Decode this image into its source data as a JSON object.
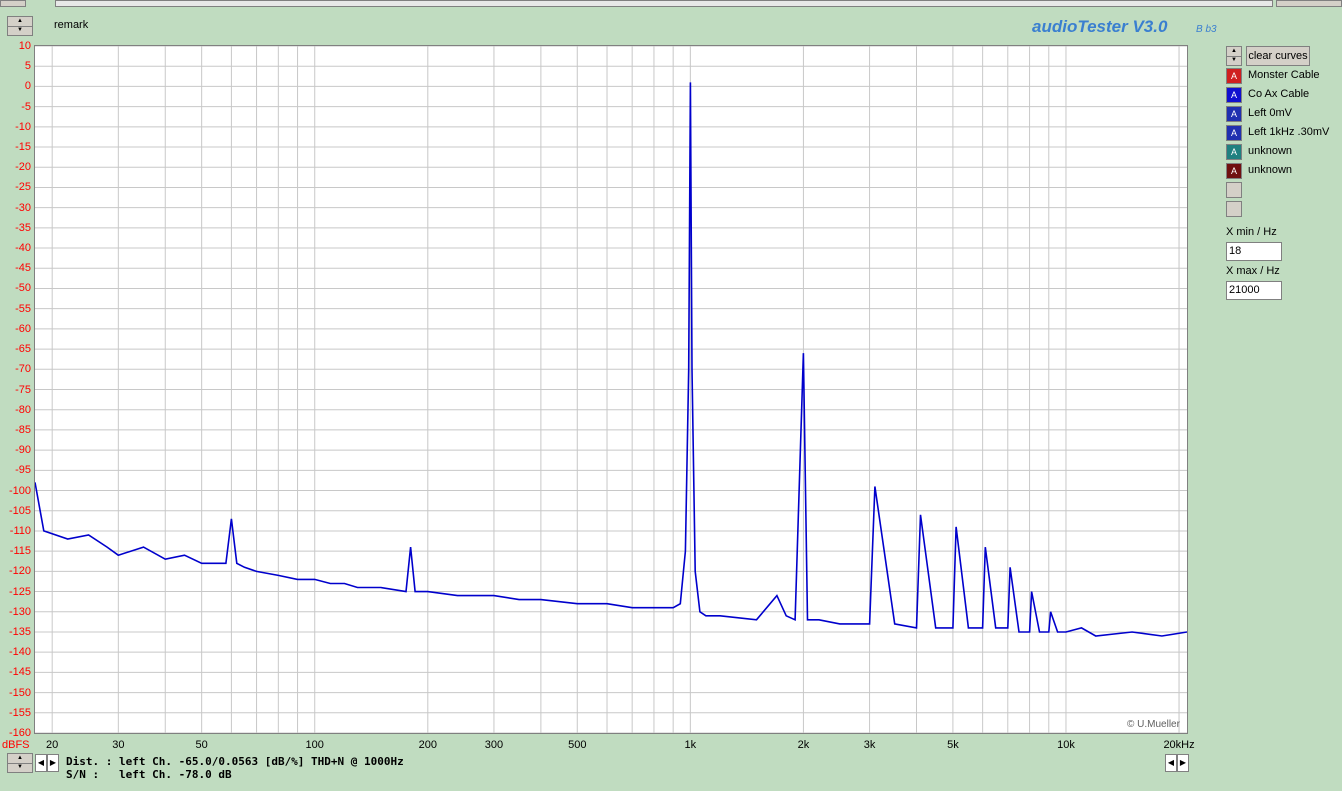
{
  "window": {
    "remark_label": "remark",
    "title": "audioTester V3.0",
    "build": "B b3",
    "copyright": "© U.Mueller"
  },
  "toolbar": {
    "clear_curves_label": "clear curves"
  },
  "curves": [
    {
      "label": "Monster Cable",
      "color": "#d02020",
      "glyph": "A"
    },
    {
      "label": "Co Ax Cable",
      "color": "#1010d0",
      "glyph": "A"
    },
    {
      "label": "Left 0mV",
      "color": "#2030b0",
      "glyph": "A"
    },
    {
      "label": "Left 1kHz .30mV",
      "color": "#2030b0",
      "glyph": "A"
    },
    {
      "label": "unknown",
      "color": "#208080",
      "glyph": "A"
    },
    {
      "label": "unknown",
      "color": "#701010",
      "glyph": "A"
    }
  ],
  "xrange": {
    "xmin_label": "X min / Hz",
    "xmin_value": "18",
    "xmax_label": "X max / Hz",
    "xmax_value": "21000"
  },
  "status": {
    "dist_label": "Dist. :",
    "dist_value": "left Ch. -65.0/0.0563 [dB/%] THD+N  @ 1000Hz",
    "sn_label": "S/N :",
    "sn_value": "left Ch. -78.0 dB"
  },
  "chart_data": {
    "type": "line",
    "xscale": "log",
    "xlim": [
      18,
      21000
    ],
    "ylim": [
      -160,
      10
    ],
    "ylabel": "dBFS",
    "xtick_labels": [
      "20",
      "30",
      "50",
      "100",
      "200",
      "300",
      "500",
      "1k",
      "2k",
      "3k",
      "5k",
      "10k",
      "20kHz"
    ],
    "xtick_values": [
      20,
      30,
      50,
      100,
      200,
      300,
      500,
      1000,
      2000,
      3000,
      5000,
      10000,
      20000
    ],
    "ytick_labels": [
      "10",
      "5",
      "0",
      "-5",
      "-10",
      "-15",
      "-20",
      "-25",
      "-30",
      "-35",
      "-40",
      "-45",
      "-50",
      "-55",
      "-60",
      "-65",
      "-70",
      "-75",
      "-80",
      "-85",
      "-90",
      "-95",
      "-100",
      "-105",
      "-110",
      "-115",
      "-120",
      "-125",
      "-130",
      "-135",
      "-140",
      "-145",
      "-150",
      "-155",
      "-160"
    ],
    "grid": true,
    "series": [
      {
        "color": "#0000cc",
        "x": [
          18,
          19,
          22,
          25,
          28,
          30,
          35,
          40,
          45,
          50,
          55,
          58,
          60,
          62,
          65,
          70,
          80,
          90,
          100,
          110,
          120,
          130,
          150,
          175,
          180,
          185,
          200,
          240,
          260,
          300,
          350,
          400,
          500,
          600,
          700,
          800,
          900,
          940,
          970,
          990,
          1000,
          1010,
          1030,
          1060,
          1100,
          1200,
          1500,
          1700,
          1800,
          1900,
          2000,
          2050,
          2200,
          2500,
          3000,
          3100,
          3500,
          4000,
          4100,
          4500,
          5000,
          5100,
          5500,
          6000,
          6100,
          6500,
          7000,
          7100,
          7500,
          8000,
          8100,
          8500,
          9000,
          9100,
          9500,
          10000,
          11000,
          12000,
          15000,
          18000,
          21000
        ],
        "y": [
          -98,
          -110,
          -112,
          -111,
          -114,
          -116,
          -114,
          -117,
          -116,
          -118,
          -118,
          -118,
          -107,
          -118,
          -119,
          -120,
          -121,
          -122,
          -122,
          -123,
          -123,
          -124,
          -124,
          -125,
          -114,
          -125,
          -125,
          -126,
          -126,
          -126,
          -127,
          -127,
          -128,
          -128,
          -129,
          -129,
          -129,
          -128,
          -115,
          -70,
          1,
          -70,
          -120,
          -130,
          -131,
          -131,
          -132,
          -126,
          -131,
          -132,
          -66,
          -132,
          -132,
          -133,
          -133,
          -99,
          -133,
          -134,
          -106,
          -134,
          -134,
          -109,
          -134,
          -134,
          -114,
          -134,
          -134,
          -119,
          -135,
          -135,
          -125,
          -135,
          -135,
          -130,
          -135,
          -135,
          -134,
          -136,
          -135,
          -136,
          -135
        ]
      }
    ]
  }
}
